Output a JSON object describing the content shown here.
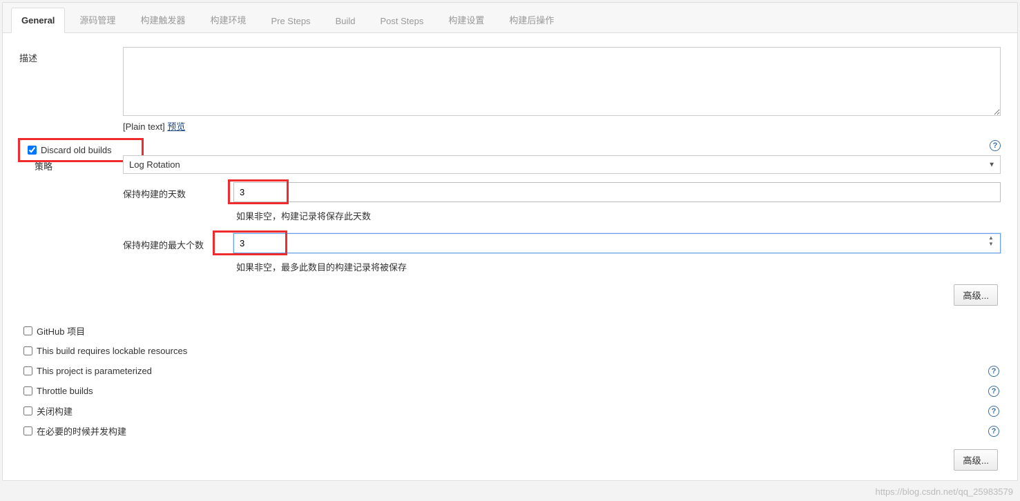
{
  "tabs": [
    {
      "id": "general",
      "label": "General",
      "active": true
    },
    {
      "id": "scm",
      "label": "源码管理",
      "active": false
    },
    {
      "id": "triggers",
      "label": "构建触发器",
      "active": false
    },
    {
      "id": "env",
      "label": "构建环境",
      "active": false
    },
    {
      "id": "pre",
      "label": "Pre Steps",
      "active": false
    },
    {
      "id": "build",
      "label": "Build",
      "active": false
    },
    {
      "id": "post",
      "label": "Post Steps",
      "active": false
    },
    {
      "id": "settings",
      "label": "构建设置",
      "active": false
    },
    {
      "id": "postbuild",
      "label": "构建后操作",
      "active": false
    }
  ],
  "description": {
    "label": "描述",
    "value": "",
    "format_prefix": "[Plain text] ",
    "preview_link": "预览"
  },
  "discard": {
    "checked": true,
    "label": "Discard old builds",
    "strategy_label": "策略",
    "strategy_value": "Log Rotation",
    "days_label": "保持构建的天数",
    "days_value": "3",
    "days_hint": "如果非空，构建记录将保存此天数",
    "max_label": "保持构建的最大个数",
    "max_value": "3",
    "max_hint": "如果非空，最多此数目的构建记录将被保存",
    "advanced_label": "高级..."
  },
  "options": [
    {
      "id": "github",
      "label": "GitHub 项目",
      "checked": false,
      "help": false
    },
    {
      "id": "lockable",
      "label": "This build requires lockable resources",
      "checked": false,
      "help": false
    },
    {
      "id": "param",
      "label": "This project is parameterized",
      "checked": false,
      "help": true
    },
    {
      "id": "throttle",
      "label": "Throttle builds",
      "checked": false,
      "help": true
    },
    {
      "id": "disable",
      "label": "关闭构建",
      "checked": false,
      "help": true
    },
    {
      "id": "concurrent",
      "label": "在必要的时候并发构建",
      "checked": false,
      "help": true
    }
  ],
  "bottom_advanced_label": "高级...",
  "watermark": "https://blog.csdn.net/qq_25983579"
}
